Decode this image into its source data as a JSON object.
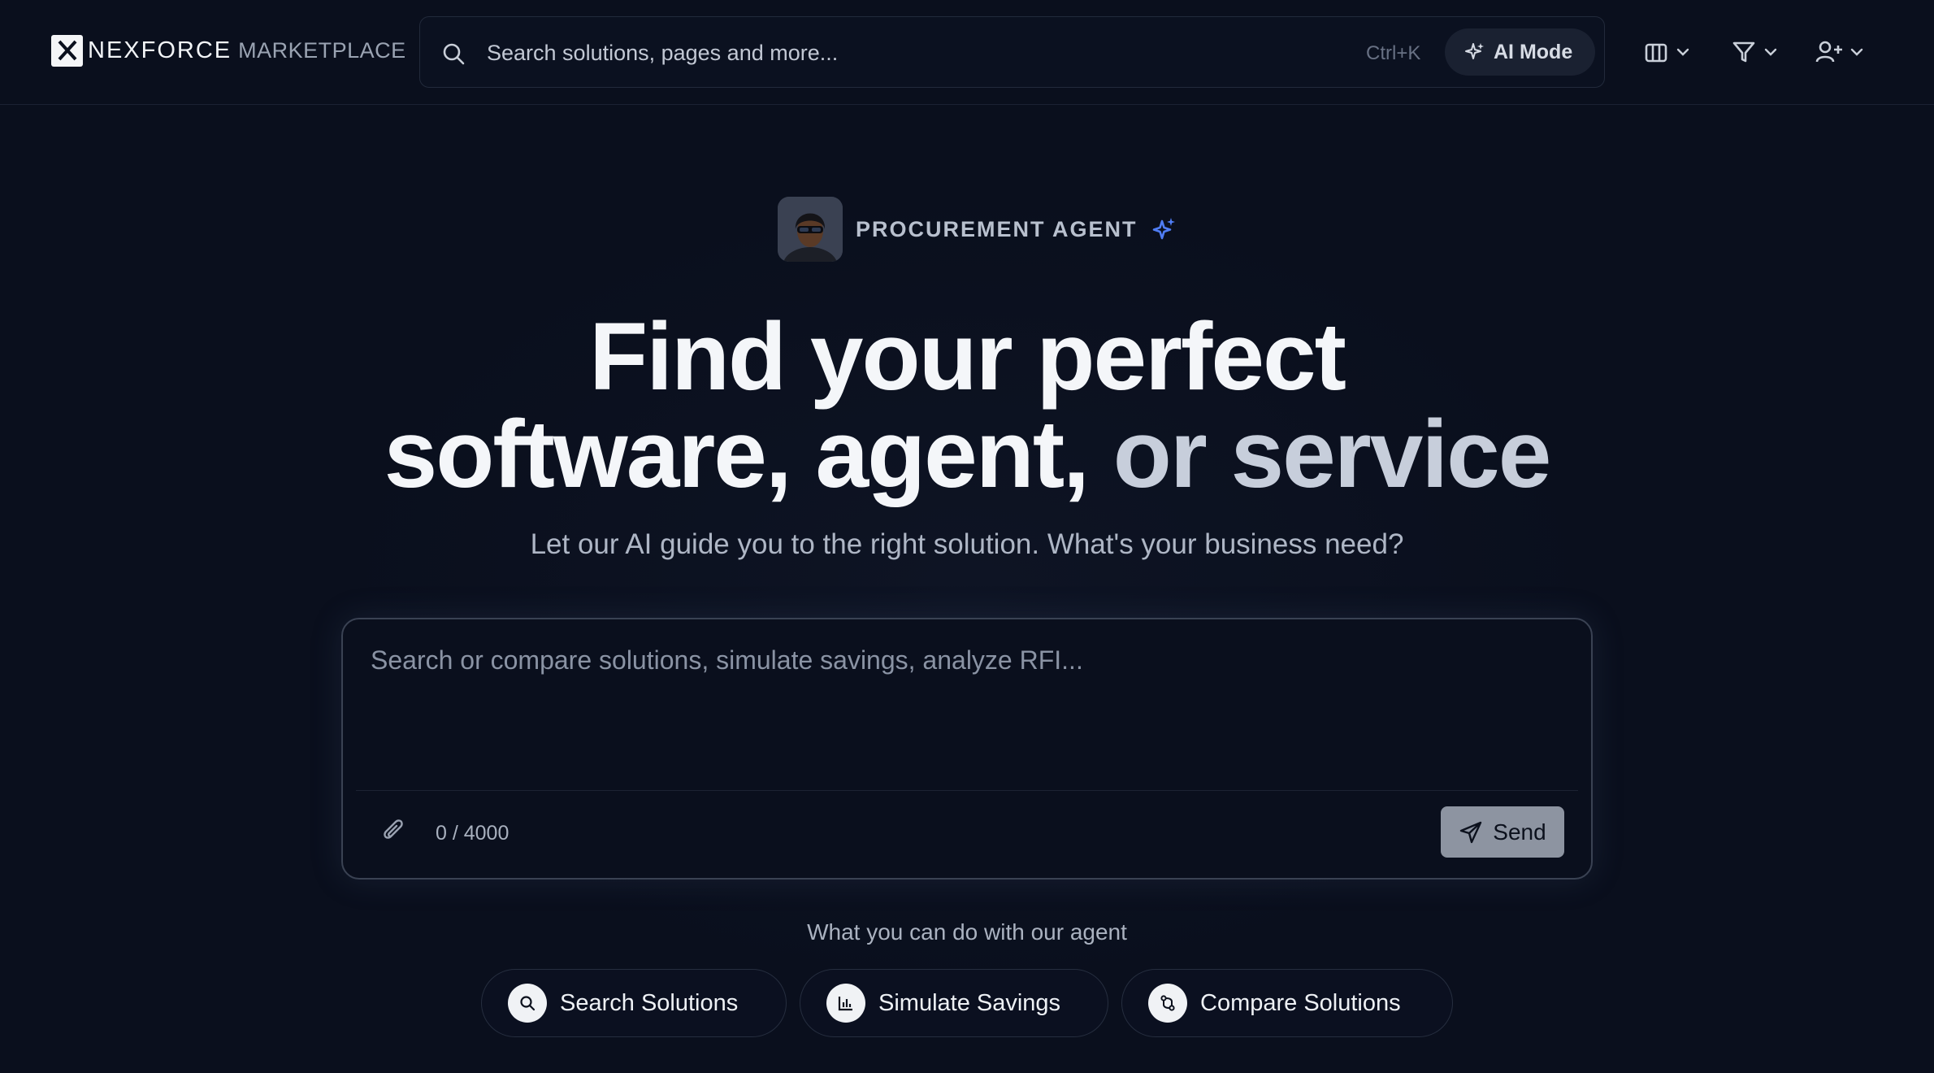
{
  "header": {
    "brand": "NEXFORCE",
    "brand_sub": "MARKETPLACE",
    "search": {
      "placeholder": "Search solutions, pages and more...",
      "shortcut": "Ctrl+K",
      "ai_mode_label": "AI Mode"
    },
    "icons": [
      "building-icon",
      "filter-icon",
      "user-plus-icon"
    ]
  },
  "hero": {
    "agent_label": "PROCUREMENT AGENT",
    "headline_line1": "Find your perfect",
    "headline_line2a": "software, agent,",
    "headline_line2b": "or service",
    "subtitle": "Let our AI guide you to the right solution. What's your business need?"
  },
  "composer": {
    "placeholder": "Search or compare solutions, simulate savings, analyze RFI...",
    "counter": "0 / 4000",
    "send_label": "Send"
  },
  "capabilities": {
    "heading": "What you can do with our agent",
    "items": [
      {
        "label": "Search Solutions",
        "icon": "search-icon"
      },
      {
        "label": "Simulate Savings",
        "icon": "bar-chart-icon"
      },
      {
        "label": "Compare Solutions",
        "icon": "compare-icon"
      }
    ]
  },
  "colors": {
    "background": "#0a0f1d",
    "accent_sparkle": "#4f7df5",
    "send_button": "#8d94a1"
  }
}
